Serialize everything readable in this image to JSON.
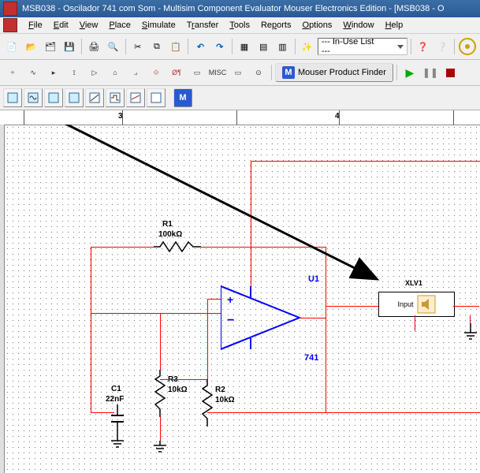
{
  "window": {
    "title": "MSB038 - Oscilador 741 com Som - Multisim Component Evaluator Mouser Electronics Edition - [MSB038 - O"
  },
  "menu": {
    "file": "File",
    "edit": "Edit",
    "view": "View",
    "place": "Place",
    "simulate": "Simulate",
    "transfer": "Transfer",
    "tools": "Tools",
    "reports": "Reports",
    "options": "Options",
    "window": "Window",
    "help": "Help"
  },
  "toolbar": {
    "in_use": " --- In-Use List --- "
  },
  "mouser": {
    "label": "Mouser Product Finder"
  },
  "ruler": {
    "mark1": "3",
    "mark2": "4"
  },
  "schematic": {
    "r1": {
      "name": "R1",
      "value": "100kΩ"
    },
    "r2": {
      "name": "R2",
      "value": "10kΩ"
    },
    "r3": {
      "name": "R3",
      "value": "10kΩ"
    },
    "c1": {
      "name": "C1",
      "value": "22nF"
    },
    "u1": {
      "name": "U1",
      "part": "741"
    },
    "inst": {
      "name": "XLV1",
      "port": "Input"
    }
  }
}
